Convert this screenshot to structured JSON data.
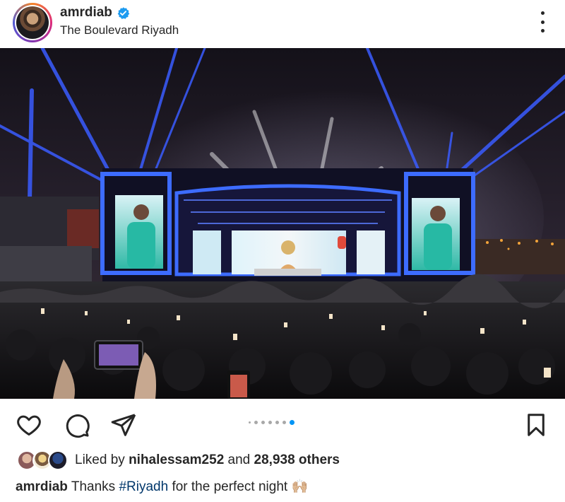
{
  "post": {
    "username": "amrdiab",
    "location": "The Boulevard Riyadh",
    "verified_icon": "verified-badge-icon",
    "more_icon": "more-options-icon"
  },
  "actions": {
    "like_icon": "heart-icon",
    "comment_icon": "comment-icon",
    "share_icon": "send-icon",
    "save_icon": "bookmark-icon"
  },
  "carousel": {
    "total": 7,
    "active_index": 6
  },
  "likes": {
    "prefix": "Liked by",
    "user": "nihalessam252",
    "and": "and",
    "others": "28,938 others"
  },
  "caption": {
    "username": "amrdiab",
    "text_before": "Thanks",
    "hashtag": "#Riyadh",
    "text_after": "for the perfect night",
    "emoji": "🙌🏼"
  },
  "colors": {
    "verified": "#1d9bf0",
    "carousel_active": "#0095f6",
    "hashtag": "#00376b",
    "stage_light": "#3a5cff"
  }
}
